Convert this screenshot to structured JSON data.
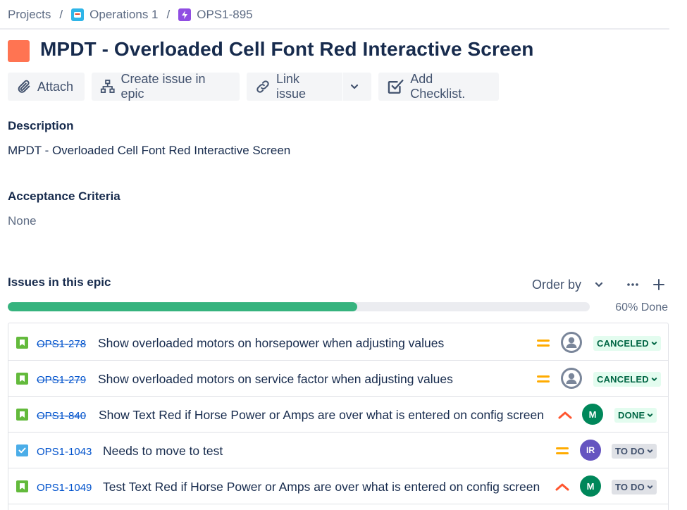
{
  "breadcrumb": {
    "projects": "Projects",
    "project": "Operations 1",
    "epic_key": "OPS1-895",
    "separator": "/"
  },
  "epic": {
    "title": "MPDT - Overloaded Cell Font Red Interactive Screen",
    "color": "#ff7452"
  },
  "toolbar": {
    "attach": "Attach",
    "create_issue_in_epic": "Create issue in epic",
    "link_issue": "Link issue",
    "add_checklist": "Add Checklist."
  },
  "description": {
    "label": "Description",
    "text": "MPDT - Overloaded Cell Font Red Interactive Screen"
  },
  "acceptance": {
    "label": "Acceptance Criteria",
    "text": "None"
  },
  "issues": {
    "label": "Issues in this epic",
    "order_by": "Order by",
    "progress_fraction": 0.6,
    "progress_text": "60% Done",
    "rows": [
      {
        "type": "story",
        "key": "OPS1-278",
        "struck": true,
        "summary": "Show overloaded motors on horsepower when adjusting values",
        "priority": "medium",
        "assignee": "unassigned",
        "status": "CANCELED",
        "status_color": "green"
      },
      {
        "type": "story",
        "key": "OPS1-279",
        "struck": true,
        "summary": "Show overloaded motors on service factor when adjusting values",
        "priority": "medium",
        "assignee": "unassigned",
        "status": "CANCELED",
        "status_color": "green"
      },
      {
        "type": "story",
        "key": "OPS1-840",
        "struck": true,
        "summary": "Show Text Red if Horse Power or Amps are over what is entered on config screen",
        "priority": "high",
        "assignee": "M",
        "status": "DONE",
        "status_color": "green"
      },
      {
        "type": "task",
        "key": "OPS1-1043",
        "struck": false,
        "summary": "Needs to move to test",
        "priority": "medium",
        "assignee": "IR",
        "status": "TO DO",
        "status_color": "grey"
      },
      {
        "type": "story",
        "key": "OPS1-1049",
        "struck": false,
        "summary": "Test Text Red if Horse Power or Amps are over what is entered on config screen",
        "priority": "high",
        "assignee": "M",
        "status": "TO DO",
        "status_color": "grey"
      }
    ]
  }
}
